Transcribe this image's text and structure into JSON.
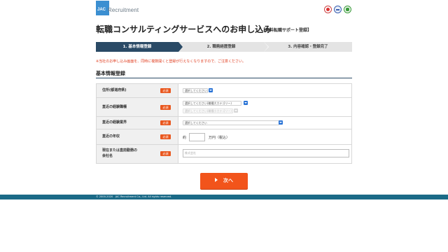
{
  "header": {
    "logo_mark": "JAC",
    "logo_text": "Recruitment",
    "badges": [
      "privacy-mark-icon",
      "security-seal-icon",
      "trust-seal-icon"
    ]
  },
  "title": {
    "main": "転職コンサルティングサービスへのお申し込み",
    "sub": "【無料転職サポート登録】"
  },
  "steps": [
    {
      "label": "1. 基本情報登録",
      "state": "active"
    },
    {
      "label": "2. 職務経歴登録",
      "state": "inactive"
    },
    {
      "label": "3. 内容確認・登録完了",
      "state": "inactive"
    }
  ],
  "notice": "※当社のお申し込み画面を、同時に複数開くと登録が行えなくなりますので、ご注意ください。",
  "section": {
    "title": "基本情報登録"
  },
  "form": {
    "required_label": "必須",
    "rows": [
      {
        "label": "住所(都道府県)",
        "select": "選択してください"
      },
      {
        "label": "直近の経験職種",
        "select": "選択してください(職種大カテゴリー)",
        "select2": "選択してください(職種小カテゴリー)"
      },
      {
        "label": "直近の経験業界",
        "select": "選択してください"
      },
      {
        "label": "直近の年収",
        "prefix": "約",
        "suffix": "万円（税込）"
      },
      {
        "label_line1": "現在または直前勤務の",
        "label_line2": "会社名",
        "placeholder": "株式会社"
      }
    ]
  },
  "next_button": "次へ",
  "footer": {
    "copyright": "© 2000-2020　JAC Recruitment Co., Ltd. All rights reserved."
  },
  "colors": {
    "accent_orange": "#f2541b",
    "step_active": "#2a4a66",
    "footer": "#1b6a87",
    "notice_red": "#e03c1e"
  }
}
